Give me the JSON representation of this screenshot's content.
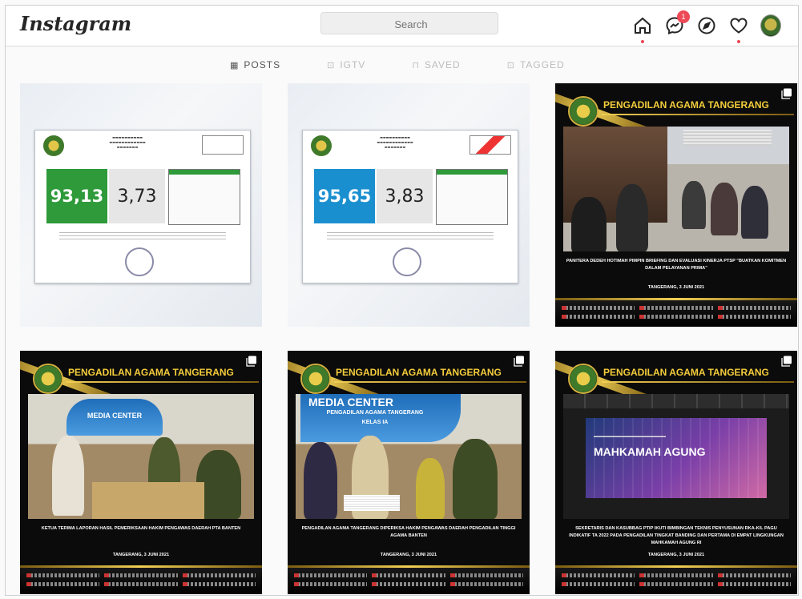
{
  "app": {
    "logo": "Instagram"
  },
  "search": {
    "placeholder": "Search"
  },
  "nav": {
    "icons": [
      "home-icon",
      "messenger-icon",
      "explore-compass-icon",
      "activity-heart-icon",
      "profile-avatar"
    ],
    "messages_badge": "1"
  },
  "tabs": [
    {
      "label": "POSTS",
      "icon": "grid-icon",
      "active": true
    },
    {
      "label": "IGTV",
      "icon": "igtv-icon",
      "active": false
    },
    {
      "label": "SAVED",
      "icon": "bookmark-icon",
      "active": false
    },
    {
      "label": "TAGGED",
      "icon": "tagged-icon",
      "active": false
    }
  ],
  "posts": [
    {
      "type": "certificate",
      "score_main": "93,13",
      "score_secondary": "3,73",
      "accent": "#2e9a3a"
    },
    {
      "type": "certificate",
      "score_main": "95,65",
      "score_secondary": "3,83",
      "accent": "#1a8fd0"
    },
    {
      "type": "news",
      "header": "PENGADILAN AGAMA TANGERANG",
      "caption": "PANITERA DEDEH HOTIMAH PIMPIN BRIEFING DAN EVALUASI KINERJA PTSP \"BUATKAN KOMITMEN DALAM PELAYANAN PRIMA\"",
      "date": "TANGERANG, 3 JUNI 2021"
    },
    {
      "type": "news",
      "header": "PENGADILAN AGAMA TANGERANG",
      "banner": "MEDIA CENTER",
      "caption": "KETUA TERIMA LAPORAN HASIL PEMERIKSAAN HAKIM PENGAWAS DAERAH PTA BANTEN",
      "date": "TANGERANG, 3 JUNI 2021"
    },
    {
      "type": "news",
      "header": "PENGADILAN AGAMA TANGERANG",
      "banner": "MEDIA CENTER",
      "banner_sub": "PENGADILAN AGAMA TANGERANG",
      "banner_sub2": "KELAS IA",
      "caption": "PENGADILAN AGAMA TANGERANG DIPERIKSA HAKIM PENGAWAS DAERAH PENGADILAN TINGGI AGAMA BANTEN",
      "date": "TANGERANG, 3 JUNI 2021"
    },
    {
      "type": "news",
      "header": "PENGADILAN AGAMA TANGERANG",
      "slide_title": "MAHKAMAH AGUNG",
      "caption": "SEKRETARIS DAN KASUBBAG PTIP IKUTI BIMBINGAN TEKNIS PENYUSUNAN RKA-K/L PAGU INDIKATIF TA 2022 PADA PENGADILAN TINGKAT BANDING DAN PERTAMA DI EMPAT LINGKUNGAN MAHKAMAH AGUNG RI",
      "date": "TANGERANG, 3 JUNI 2021"
    }
  ]
}
